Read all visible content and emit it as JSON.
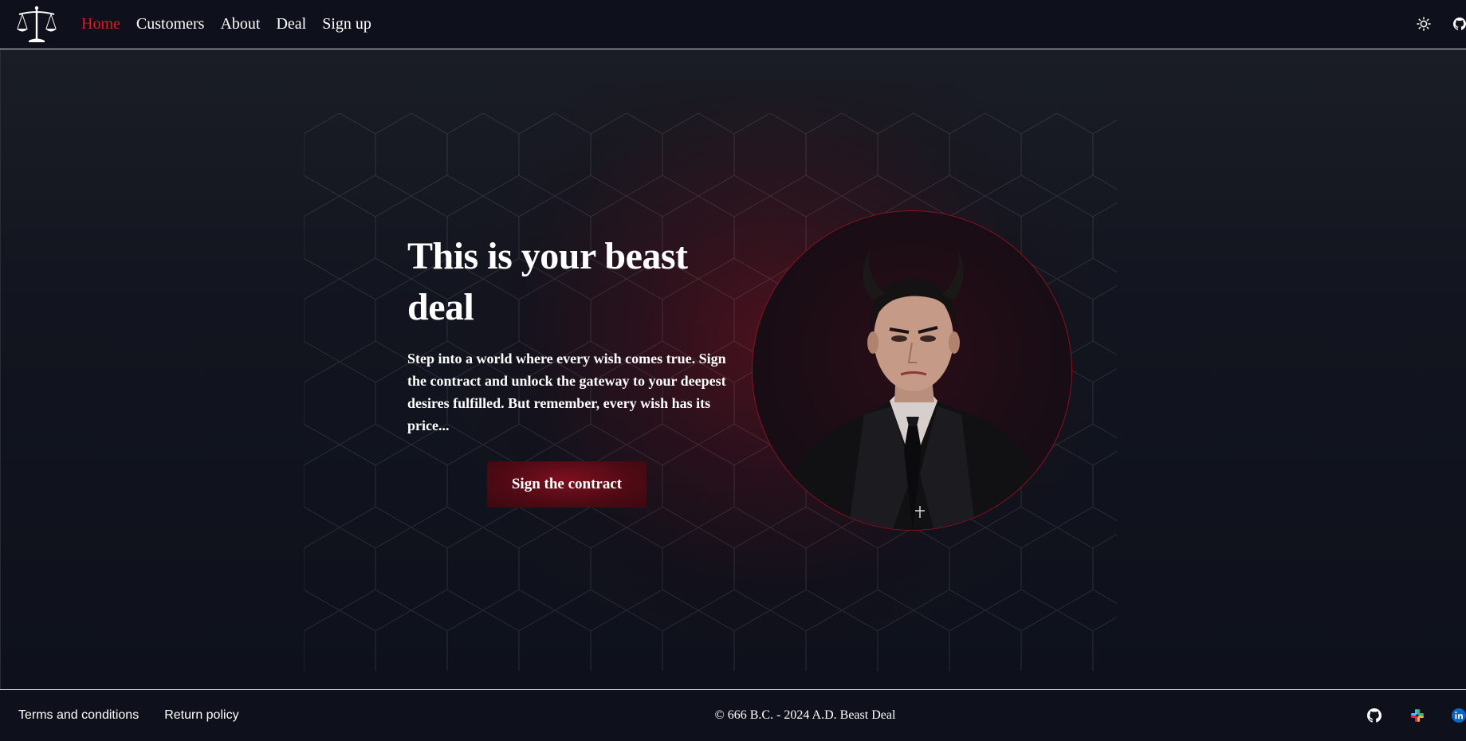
{
  "nav": {
    "logo_icon": "scales-of-justice-icon",
    "links": [
      {
        "label": "Home",
        "active": true
      },
      {
        "label": "Customers",
        "active": false
      },
      {
        "label": "About",
        "active": false
      },
      {
        "label": "Deal",
        "active": false
      },
      {
        "label": "Sign up",
        "active": false
      }
    ],
    "theme_toggle_icon": "sun-icon",
    "github_icon": "github-icon"
  },
  "hero": {
    "title": "This is your beast deal",
    "text": "Step into a world where every wish comes true. Sign the contract and unlock the gateway to your deepest desires fulfilled. But remember, every wish has its price...",
    "cta_label": "Sign the contract",
    "image": "devil-businessman-portrait"
  },
  "footer": {
    "links": [
      "Terms and conditions",
      "Return policy"
    ],
    "copyright": "© 666 B.C. - 2024 A.D. Beast Deal",
    "social_icons": [
      "github-icon",
      "slack-icon",
      "linkedin-icon"
    ]
  },
  "colors": {
    "background": "#0e111b",
    "accent": "#e3161f",
    "cta_background": "#6a0c1a",
    "text": "#ffffff"
  }
}
